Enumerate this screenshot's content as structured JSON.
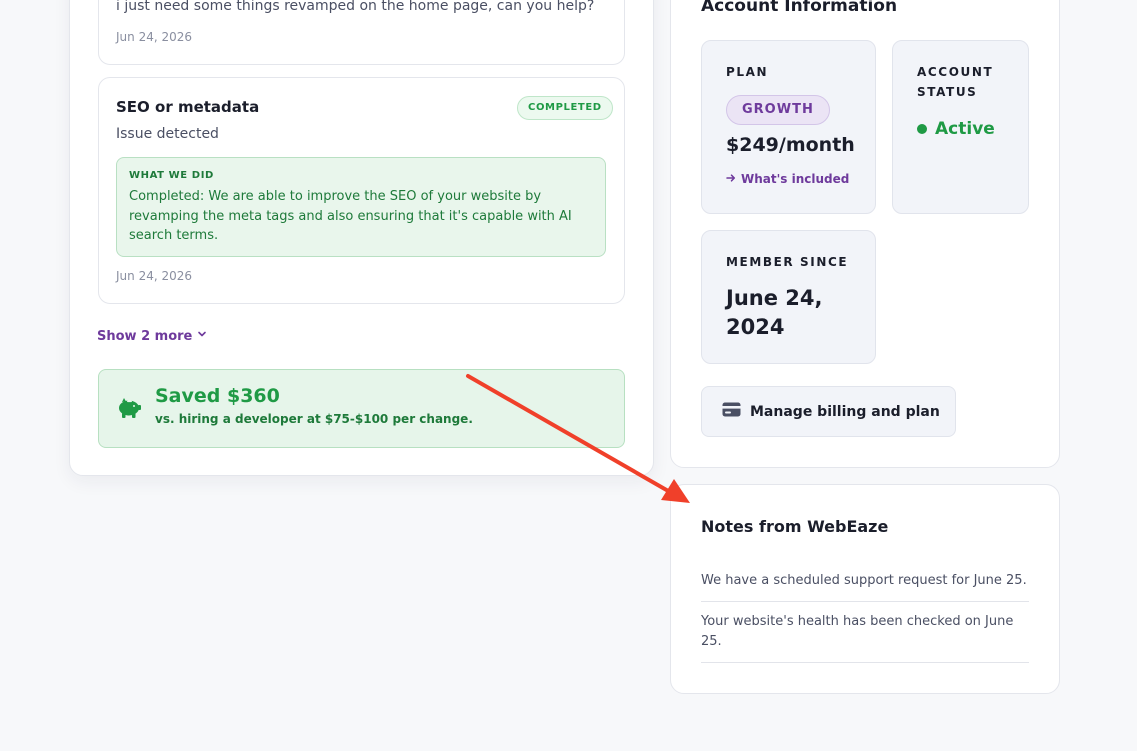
{
  "requests": {
    "first": {
      "text": "i just need some things revamped on the home page, can you help?",
      "date": "Jun 24, 2026"
    },
    "second": {
      "title": "SEO or metadata",
      "badge": "COMPLETED",
      "subtitle": "Issue detected",
      "what_we_did_label": "WHAT WE DID",
      "what_we_did_text": "Completed: We are able to improve the SEO of your website by revamping the meta tags and also ensuring that it's capable with AI search terms.",
      "date": "Jun 24, 2026"
    },
    "show_more_label": "Show 2 more"
  },
  "savings": {
    "title": "Saved $360",
    "subtitle": "vs. hiring a developer at $75-$100 per change."
  },
  "account": {
    "title": "Account Information",
    "plan_label": "PLAN",
    "plan_name": "GROWTH",
    "plan_price": "$249/month",
    "plan_link": "What's included",
    "status_label": "ACCOUNT STATUS",
    "status_value": "Active",
    "member_label": "MEMBER SINCE",
    "member_value": "June 24, 2024",
    "billing_button": "Manage billing and plan"
  },
  "notes": {
    "title": "Notes from WebEaze",
    "items": [
      "We have a scheduled support request for June 25.",
      "Your website's health has been checked on June 25."
    ]
  },
  "colors": {
    "accent_purple": "#6e3a9c",
    "success_green": "#1f9a45",
    "annotation_red": "#f0402a"
  },
  "icons": {
    "chevron": "chevron-down-icon",
    "arrow": "arrow-right-icon",
    "piggy": "piggy-bank-icon",
    "card": "credit-card-icon"
  }
}
